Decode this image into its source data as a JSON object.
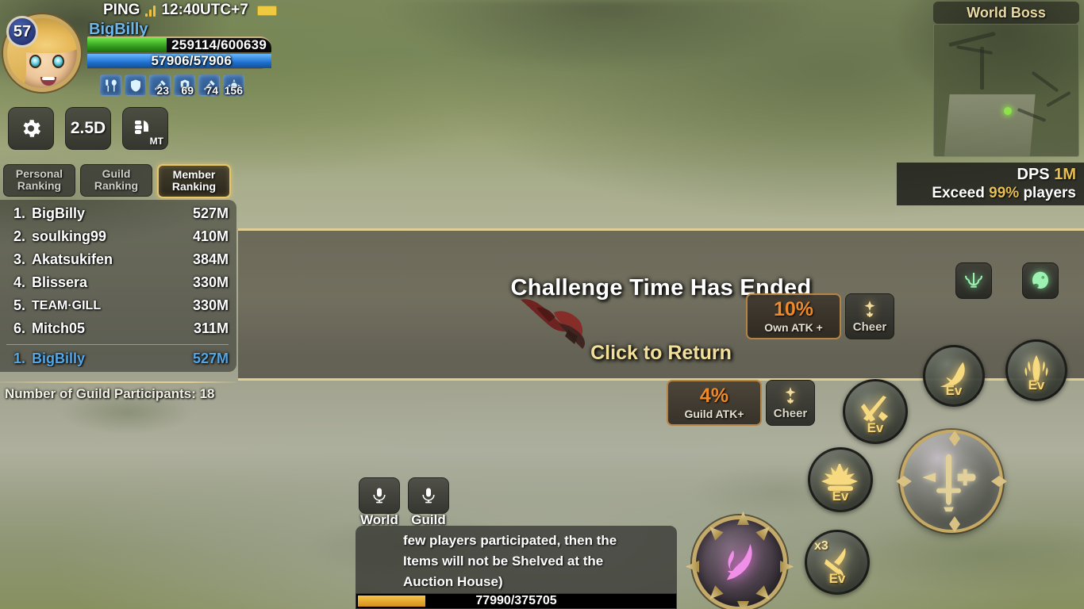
{
  "hud": {
    "ping_label": "PING",
    "clock": "12:40UTC+7",
    "level": "57",
    "player_name": "BigBilly",
    "hp_text": "259114/600639",
    "mp_text": "57906/57906",
    "hp_percent": 43,
    "mp_percent": 100,
    "stats": [
      {
        "icon": "food-icon",
        "value": ""
      },
      {
        "icon": "shield-icon",
        "value": ""
      },
      {
        "icon": "attack-icon",
        "value": "23"
      },
      {
        "icon": "defense-icon",
        "value": "69"
      },
      {
        "icon": "attack-alt-icon",
        "value": "74"
      },
      {
        "icon": "power-icon",
        "value": "156"
      }
    ]
  },
  "controls": {
    "settings_label": "gear-icon",
    "view_label": "2.5D",
    "auto_label": "MT"
  },
  "ranking": {
    "tabs": [
      {
        "label_line1": "Personal",
        "label_line2": "Ranking",
        "active": false
      },
      {
        "label_line1": "Guild",
        "label_line2": "Ranking",
        "active": false
      },
      {
        "label_line1": "Member",
        "label_line2": "Ranking",
        "active": true
      }
    ],
    "rows": [
      {
        "no": "1.",
        "name": "BigBilly",
        "score": "527M"
      },
      {
        "no": "2.",
        "name": "soulking99",
        "score": "410M"
      },
      {
        "no": "3.",
        "name": "Akatsukifen",
        "score": "384M"
      },
      {
        "no": "4.",
        "name": "Blissera",
        "score": "330M"
      },
      {
        "no": "5.",
        "name": "TEAM·GILL",
        "score": "330M"
      },
      {
        "no": "6.",
        "name": "Mitch05",
        "score": "311M"
      }
    ],
    "self_row": {
      "no": "1.",
      "name": "BigBilly",
      "score": "527M"
    },
    "participants": "Number of Guild Participants: 18"
  },
  "banner": {
    "title": "Challenge Time Has Ended",
    "subtitle": "Click to Return"
  },
  "dps": {
    "label": "DPS",
    "value": "1M",
    "exceed_prefix": "Exceed",
    "exceed_value": "99%",
    "exceed_suffix": "players"
  },
  "world_boss": {
    "title": "World Boss"
  },
  "cheers": [
    {
      "percent": "10%",
      "caption": "Own ATK +",
      "button_label": "Cheer"
    },
    {
      "percent": "4%",
      "caption": "Guild ATK+",
      "button_label": "Cheer"
    }
  ],
  "skills": [
    {
      "name": "skill-crescent",
      "badge": "Ev",
      "count": ""
    },
    {
      "name": "skill-spear",
      "badge": "Ev",
      "count": ""
    },
    {
      "name": "skill-slash",
      "badge": "Ev",
      "count": ""
    },
    {
      "name": "skill-burst",
      "badge": "Ev",
      "count": ""
    },
    {
      "name": "skill-strike",
      "badge": "Ev",
      "count": "x3"
    }
  ],
  "chat": {
    "tabs": [
      {
        "label": "World",
        "icon": "microphone-icon"
      },
      {
        "label": "Guild",
        "icon": "microphone-icon"
      }
    ],
    "lines": [
      "few players participated, then the",
      "Items will not be Shelved at the",
      "Auction House)"
    ],
    "hp_text": "77990/375705",
    "hp_percent": 21
  },
  "colors": {
    "gold": "#e8bf52",
    "banner_gold": "#e0ce95",
    "player_blue": "#6fb6e8",
    "orange": "#f08a28",
    "hp_green": "#2f9a1c",
    "mp_blue": "#1f6fd0"
  }
}
